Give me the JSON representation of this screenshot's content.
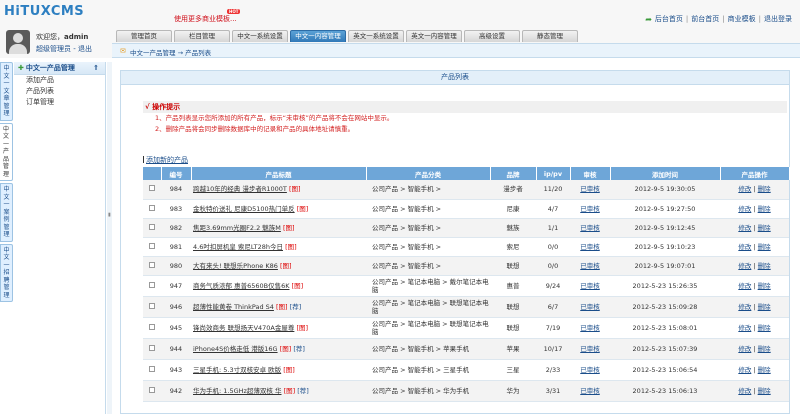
{
  "header": {
    "logo_main": "HiTUX",
    "logo_x": "",
    "logo_suffix": "CMS",
    "promo_text": "使用更多商业模板...",
    "promo_badge": "HOT",
    "links": {
      "front_home": "后台首页",
      "site_home": "前台首页",
      "templates": "商业模板",
      "logout": "退出登录"
    },
    "welcome_prefix": "欢迎您，",
    "username": "admin",
    "role_text": "超级管理员 - 退出"
  },
  "nav": {
    "tabs": [
      {
        "label": "管理首页",
        "active": false
      },
      {
        "label": "栏目管理",
        "active": false
      },
      {
        "label": "中文一系统设置",
        "active": false
      },
      {
        "label": "中文一内容管理",
        "active": true
      },
      {
        "label": "英文一系统设置",
        "active": false
      },
      {
        "label": "英文一内容管理",
        "active": false
      },
      {
        "label": "高级设置",
        "active": false
      },
      {
        "label": "静态管理",
        "active": false
      }
    ]
  },
  "breadcrumb": "中文一产品管理 → 产品列表",
  "side_tabs": [
    {
      "label": "中文一文章管理",
      "active": false
    },
    {
      "label": "中文一产品管理",
      "active": true
    },
    {
      "label": "中文一案例管理",
      "active": false
    },
    {
      "label": "中文一招聘管理",
      "active": false
    }
  ],
  "left_menu": {
    "title": "中文一产品管理",
    "collapse_glyph": "⇑",
    "items": [
      "添加产品",
      "产品列表",
      "订单管理"
    ]
  },
  "main": {
    "title": "产品列表",
    "tips_title": "√ 操作提示",
    "tips": [
      "1、产品列表显示您所添加的所有产品，标示“未审核”的产品将不会在网站中显示。",
      "2、删除产品将会同步删除数据库中的记录和产品的具体地址请慎重。"
    ],
    "add_new": "添加新的产品"
  },
  "table": {
    "headers": [
      "",
      "编号",
      "产品标题",
      "产品分类",
      "品牌",
      "ip/pv",
      "审核",
      "添加时间",
      "产品操作"
    ],
    "review_label": "已审核",
    "edit_label": "修改",
    "delete_label": "删除",
    "rows": [
      {
        "id": "984",
        "title": "跨越10年的经典 漫步者R1000T",
        "tags": [
          "[图]"
        ],
        "category": "公司产品 > 智能手机 >",
        "brand": "漫步者",
        "ippv": "11/20",
        "time": "2012-9-5 19:30:05"
      },
      {
        "id": "983",
        "title": "金秋特价送礼 尼康D5100热门单反",
        "tags": [
          "[图]"
        ],
        "category": "公司产品 > 智能手机 >",
        "brand": "尼康",
        "ippv": "4/7",
        "time": "2012-9-5 19:27:50"
      },
      {
        "id": "982",
        "title": "焦距3.69mm光圈F2.2 魅族M",
        "tags": [
          "[图]"
        ],
        "category": "公司产品 > 智能手机 >",
        "brand": "魅族",
        "ippv": "1/1",
        "time": "2012-9-5 19:12:45"
      },
      {
        "id": "981",
        "title": "4.6吋扣屏机皇 索尼LT28h今日",
        "tags": [
          "[图]"
        ],
        "category": "公司产品 > 智能手机 >",
        "brand": "索尼",
        "ippv": "0/0",
        "time": "2012-9-5 19:10:23"
      },
      {
        "id": "980",
        "title": "大有来头! 联想乐Phone K86",
        "tags": [
          "[图]"
        ],
        "category": "公司产品 > 智能手机 >",
        "brand": "联想",
        "ippv": "0/0",
        "time": "2012-9-5 19:07:01"
      },
      {
        "id": "947",
        "title": "商务气质浓郁 惠普6560B仅售6K",
        "tags": [
          "[图]"
        ],
        "category": "公司产品 > 笔记本电脑 > 戴尔笔记本电脑",
        "brand": "惠普",
        "ippv": "9/24",
        "time": "2012-5-23 15:26:35"
      },
      {
        "id": "946",
        "title": "超薄性能黄卷 ThinkPad S4",
        "tags": [
          "[图]",
          "[荐]"
        ],
        "category": "公司产品 > 笔记本电脑 > 联想笔记本电脑",
        "brand": "联想",
        "ippv": "6/7",
        "time": "2012-5-23 15:09:28"
      },
      {
        "id": "945",
        "title": "锋尚效商务 联想扬天V470A金屋尊",
        "tags": [
          "[图]"
        ],
        "category": "公司产品 > 笔记本电脑 > 联想笔记本电脑",
        "brand": "联想",
        "ippv": "7/19",
        "time": "2012-5-23 15:08:01"
      },
      {
        "id": "944",
        "title": "iPhone4S价格走低 港版16G",
        "tags": [
          "[图]",
          "[荐]"
        ],
        "category": "公司产品 > 智能手机 > 苹果手机",
        "brand": "苹果",
        "ippv": "10/17",
        "time": "2012-5-23 15:07:39"
      },
      {
        "id": "943",
        "title": "三星手机: 5.3寸双核安卓 欧版",
        "tags": [
          "[图]"
        ],
        "category": "公司产品 > 智能手机 > 三星手机",
        "brand": "三星",
        "ippv": "2/33",
        "time": "2012-5-23 15:06:54"
      },
      {
        "id": "942",
        "title": "华为手机: 1.5GHz超薄双核 华",
        "tags": [
          "[图]",
          "[荐]"
        ],
        "category": "公司产品 > 智能手机 > 华为手机",
        "brand": "华为",
        "ippv": "3/31",
        "time": "2012-5-23 15:06:13"
      }
    ]
  },
  "colors": {
    "accent": "#3179b8",
    "header_row": "#6ea6d8",
    "warning": "#d32121"
  }
}
